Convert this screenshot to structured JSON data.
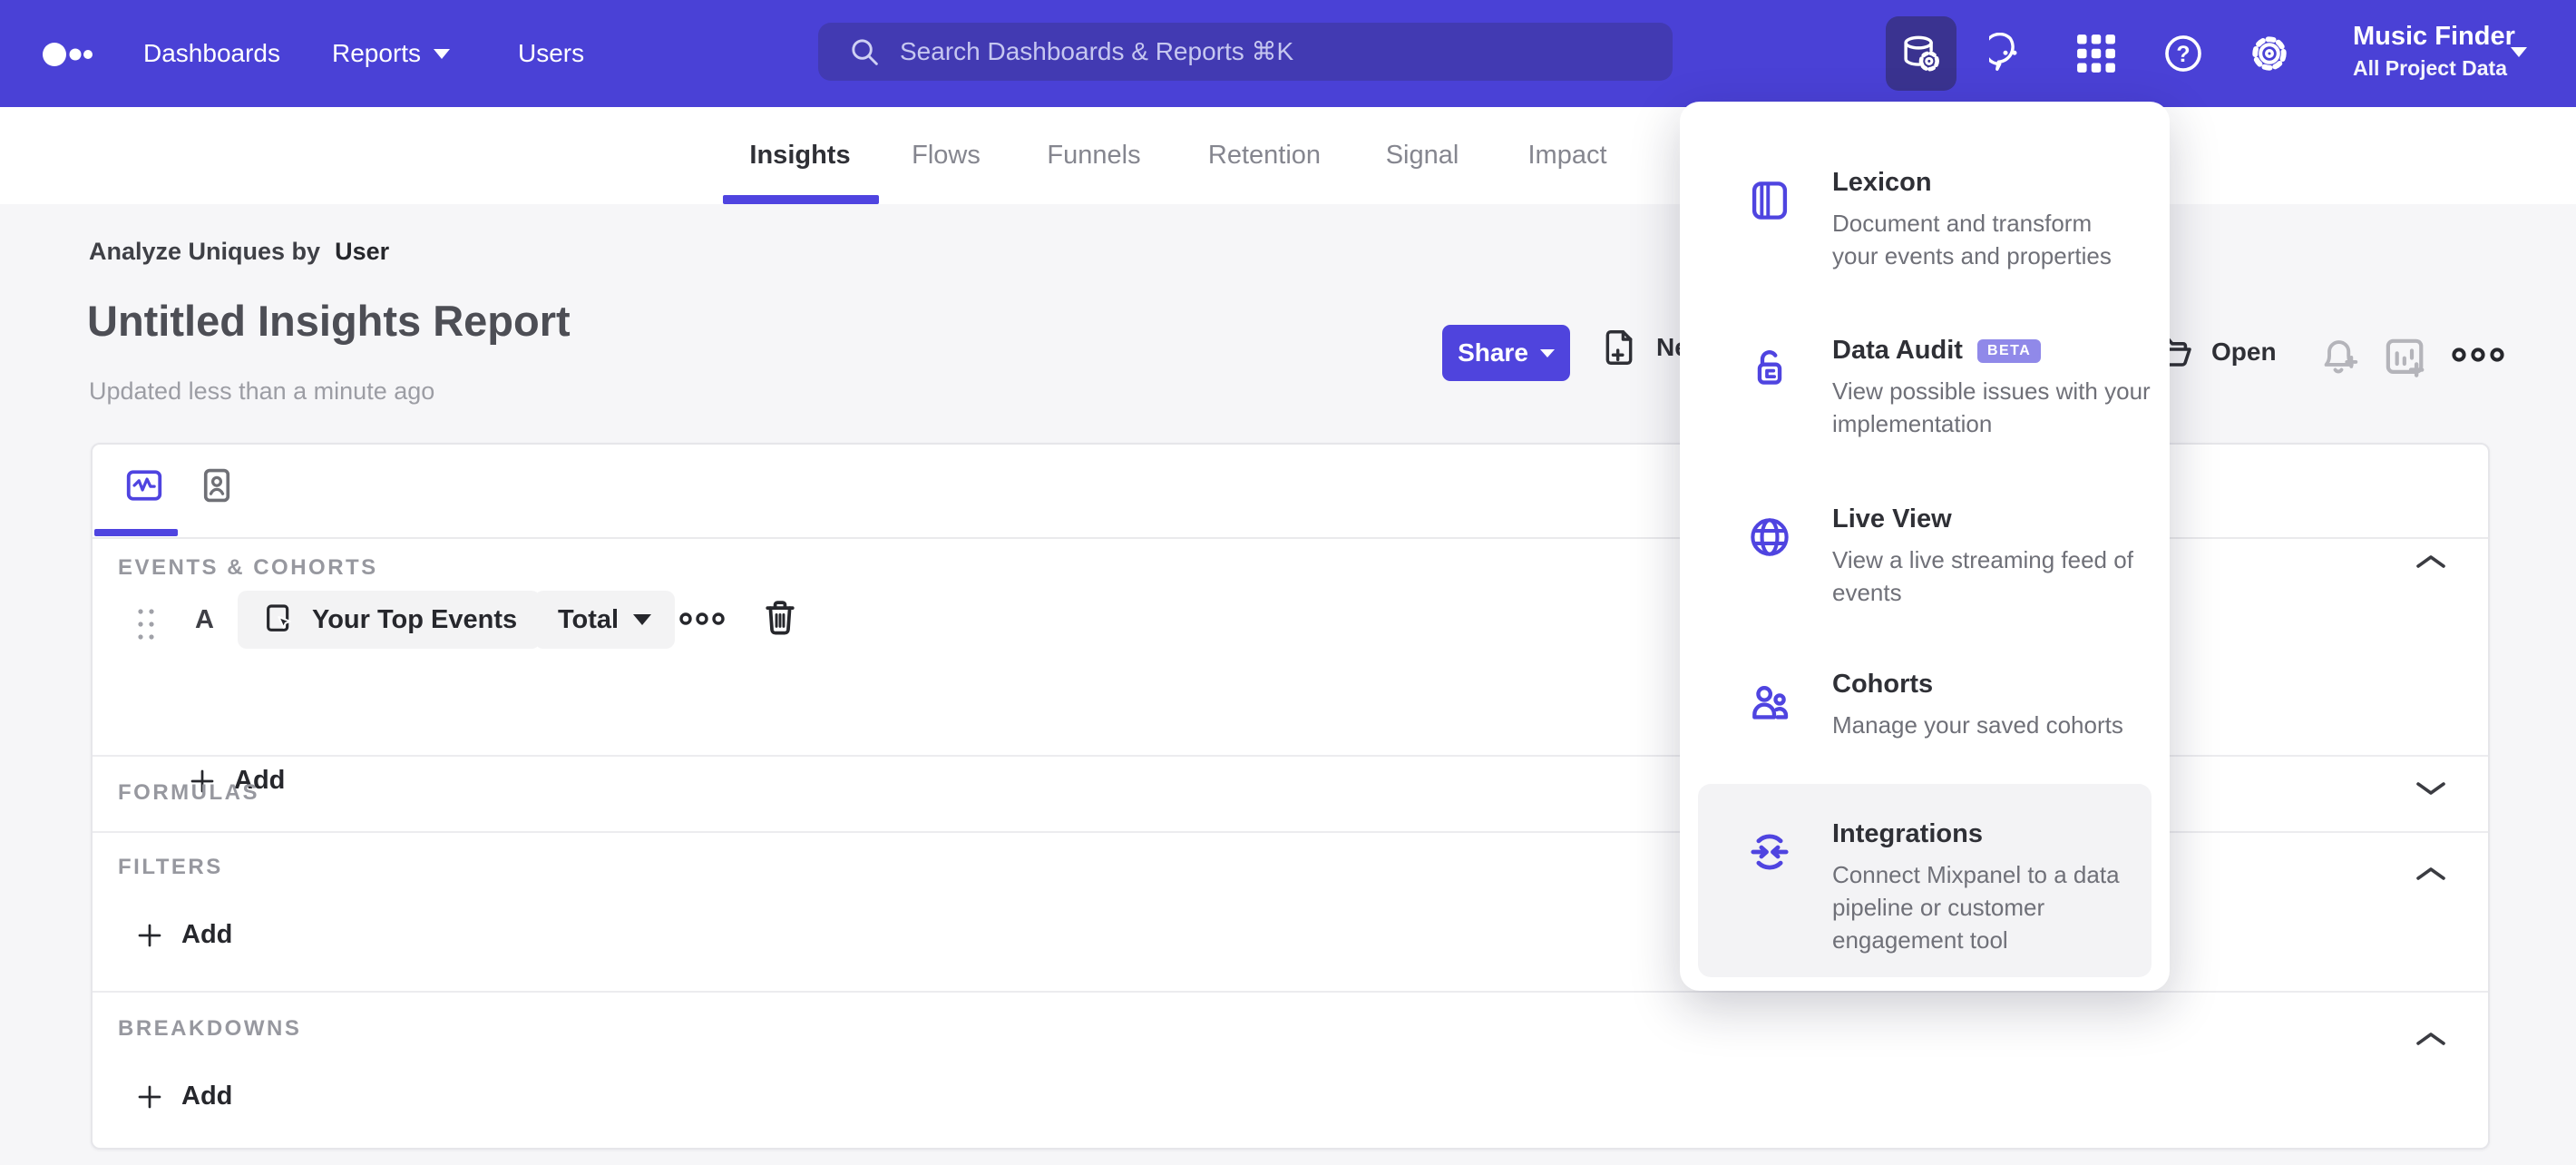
{
  "nav": {
    "links": [
      {
        "label": "Dashboards"
      },
      {
        "label": "Reports"
      },
      {
        "label": "Users"
      }
    ],
    "search": {
      "placeholder": "Search Dashboards & Reports ⌘K"
    },
    "project": {
      "name": "Music Finder",
      "scope": "All Project Data"
    }
  },
  "tabs": {
    "items": [
      {
        "label": "Insights"
      },
      {
        "label": "Flows"
      },
      {
        "label": "Funnels"
      },
      {
        "label": "Retention"
      },
      {
        "label": "Signal"
      },
      {
        "label": "Impact"
      }
    ]
  },
  "header": {
    "analyze_prefix": "Analyze Uniques by",
    "analyze_value": "User",
    "title": "Untitled Insights Report",
    "updated": "Updated less than a minute ago",
    "share_label": "Share",
    "new_label": "New",
    "open_label": "Open"
  },
  "builder": {
    "sections": {
      "events": {
        "label": "EVENTS & COHORTS"
      },
      "formulas": {
        "label": "FORMULAS"
      },
      "filters": {
        "label": "FILTERS"
      },
      "breakdowns": {
        "label": "BREAKDOWNS"
      }
    },
    "event_row": {
      "letter": "A",
      "event_label": "Your Top Events",
      "metric_label": "Total"
    },
    "add_label": "Add"
  },
  "menu": {
    "items": [
      {
        "title": "Lexicon",
        "description": "Document and transform your events and properties"
      },
      {
        "title": "Data Audit",
        "badge": "BETA",
        "description": "View possible issues with your implementation"
      },
      {
        "title": "Live View",
        "description": "View a live streaming feed of events"
      },
      {
        "title": "Cohorts",
        "description": "Manage your saved cohorts"
      },
      {
        "title": "Integrations",
        "description": "Connect Mixpanel to a data pipeline or customer engagement tool"
      }
    ]
  },
  "colors": {
    "nav_background": "#4a41d6",
    "search_background": "#423ab2",
    "active_tile": "#3a3390",
    "accent_purple": "#4f44e0",
    "beta_badge": "#9089e9",
    "page_background": "#f6f6f8"
  }
}
